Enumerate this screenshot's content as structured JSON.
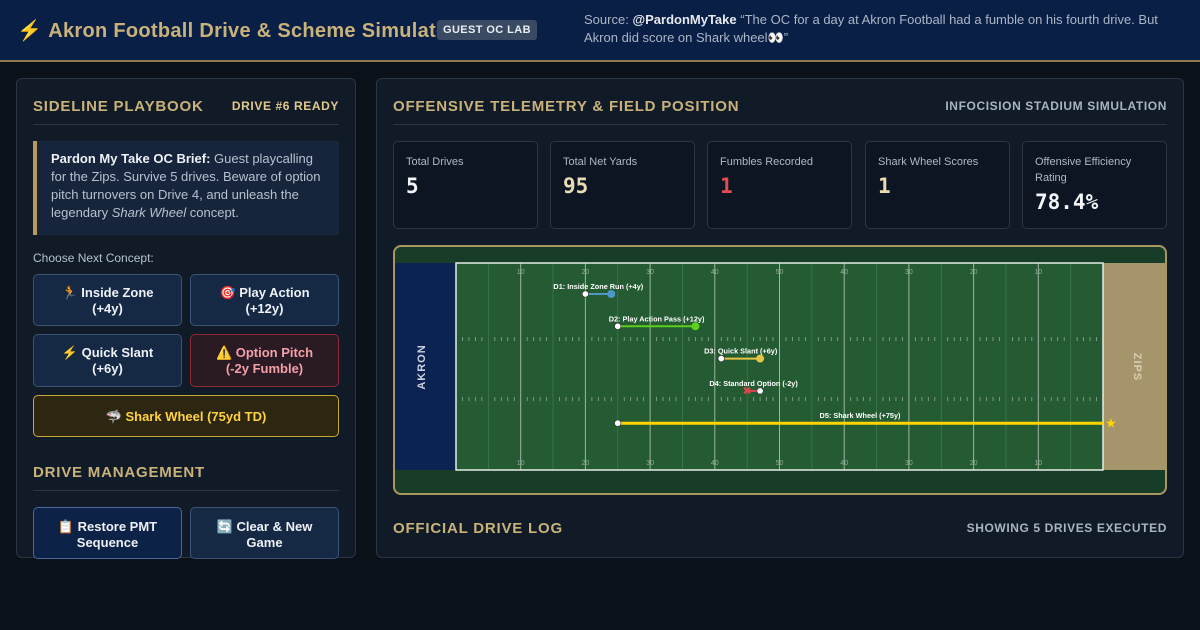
{
  "header": {
    "title": "Akron Football Drive & Scheme Simulator",
    "badge": "GUEST OC LAB",
    "source_label": "Source:",
    "source_handle": "@PardonMyTake",
    "source_quote": "“The OC for a day at Akron Football had a fumble on his fourth drive. But Akron did score on Shark wheel👀”"
  },
  "playbook": {
    "title": "SIDELINE PLAYBOOK",
    "status": "DRIVE #6 READY",
    "brief_lead": "Pardon My Take OC Brief:",
    "brief_text": " Guest playcalling for the Zips. Survive 5 drives. Beware of option pitch turnovers on Drive 4, and unleash the legendary ",
    "brief_em": "Shark Wheel",
    "brief_tail": " concept.",
    "choose_label": "Choose Next Concept:",
    "concepts": [
      {
        "line1": "🏃 Inside Zone",
        "line2": "(+4y)"
      },
      {
        "line1": "🎯 Play Action",
        "line2": "(+12y)"
      },
      {
        "line1": "⚡ Quick Slant",
        "line2": "(+6y)"
      },
      {
        "line1": "⚠️ Option Pitch",
        "line2": "(-2y Fumble)"
      },
      {
        "line1": "🦈 Shark Wheel (75yd TD)",
        "line2": ""
      }
    ]
  },
  "management": {
    "title": "DRIVE MANAGEMENT",
    "restore": {
      "line1": "📋 Restore PMT",
      "line2": "Sequence"
    },
    "clear": {
      "line1": "🔄 Clear & New",
      "line2": "Game"
    }
  },
  "telemetry": {
    "title": "OFFENSIVE TELEMETRY & FIELD POSITION",
    "venue": "INFOCISION STADIUM SIMULATION",
    "stats": [
      {
        "label": "Total Drives",
        "value": "5"
      },
      {
        "label": "Total Net Yards",
        "value": "95"
      },
      {
        "label": "Fumbles Recorded",
        "value": "1"
      },
      {
        "label": "Shark Wheel Scores",
        "value": "1"
      },
      {
        "label": "Offensive Efficiency Rating",
        "value": "78.4%"
      }
    ]
  },
  "field": {
    "left_endzone": "AKRON",
    "right_endzone": "ZIPS",
    "yard_numbers": [
      "10",
      "20",
      "30",
      "40",
      "50",
      "40",
      "30",
      "20",
      "10"
    ],
    "colors": {
      "turf": "#245b32",
      "akron_endzone": "#0b2350",
      "zips_endzone": "#a6956a",
      "gold": "#ffd400"
    },
    "drives": [
      {
        "label": "D1: Inside Zone Run (+4y)",
        "start": 20,
        "end": 24,
        "color": "#4f97c9",
        "marker": "dot"
      },
      {
        "label": "D2: Play Action Pass (+12y)",
        "start": 25,
        "end": 37,
        "color": "#5ccf1c",
        "marker": "dot"
      },
      {
        "label": "D3: Quick Slant (+6y)",
        "start": 41,
        "end": 47,
        "color": "#e7c445",
        "marker": "dot"
      },
      {
        "label": "D4: Standard Option (-2y)",
        "start": 47,
        "end": 45,
        "color": "#e0434b",
        "marker": "x"
      },
      {
        "label": "D5: Shark Wheel (+75y)",
        "start": 25,
        "end": 100,
        "color": "#ffd400",
        "marker": "star"
      }
    ]
  },
  "log": {
    "title": "OFFICIAL DRIVE LOG",
    "aside": "SHOWING 5 DRIVES EXECUTED"
  }
}
